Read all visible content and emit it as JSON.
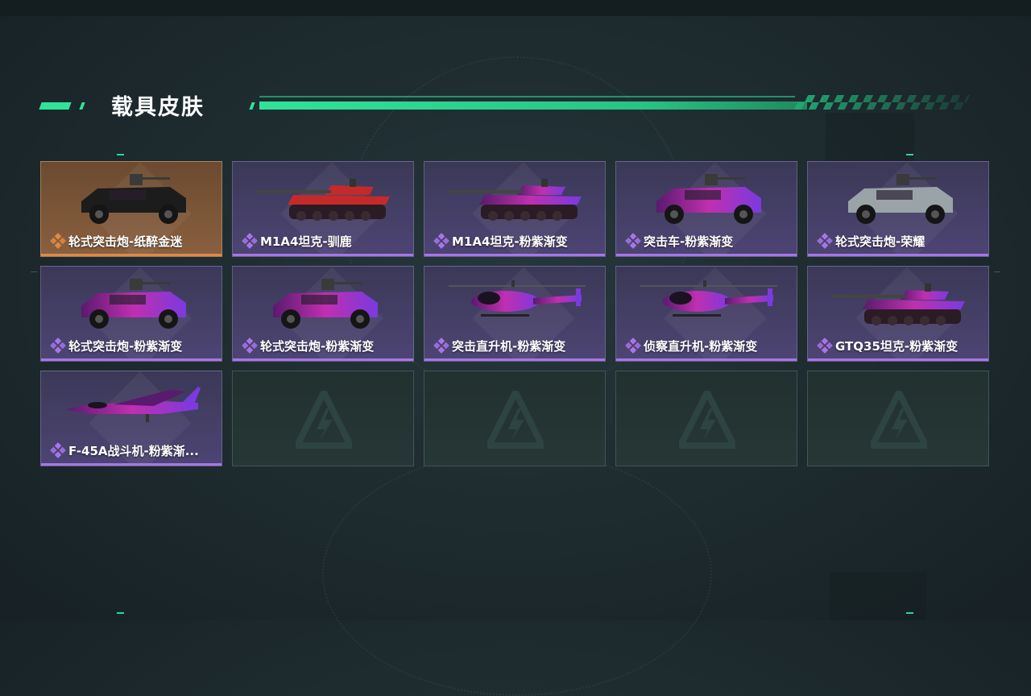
{
  "section": {
    "title": "载具皮肤"
  },
  "skins": [
    {
      "name": "轮式突击炮-纸醉金迷",
      "rarity": "gold",
      "art": "armored-vehicle-black"
    },
    {
      "name": "M1A4坦克-驯鹿",
      "rarity": "purple",
      "art": "tank-red"
    },
    {
      "name": "M1A4坦克-粉紫渐变",
      "rarity": "purple",
      "art": "tank-purple"
    },
    {
      "name": "突击车-粉紫渐变",
      "rarity": "purple",
      "art": "assault-car-purple"
    },
    {
      "name": "轮式突击炮-荣耀",
      "rarity": "purple",
      "art": "armored-vehicle-grey"
    },
    {
      "name": "轮式突击炮-粉紫渐变",
      "rarity": "purple",
      "art": "armored-vehicle-purple"
    },
    {
      "name": "轮式突击炮-粉紫渐变",
      "rarity": "purple",
      "art": "armored-vehicle-purple"
    },
    {
      "name": "突击直升机-粉紫渐变",
      "rarity": "purple",
      "art": "attack-helicopter-purple"
    },
    {
      "name": "侦察直升机-粉紫渐变",
      "rarity": "purple",
      "art": "scout-helicopter-purple"
    },
    {
      "name": "GTQ35坦克-粉紫渐变",
      "rarity": "purple",
      "art": "tank-purple"
    },
    {
      "name": "F-45A战斗机-粉紫渐...",
      "rarity": "purple",
      "art": "fighter-jet-purple"
    }
  ],
  "empty_slots": 4,
  "colors": {
    "accent": "#2fe39a",
    "purple_rarity": "#a676e8",
    "gold_rarity": "#e08a45"
  }
}
